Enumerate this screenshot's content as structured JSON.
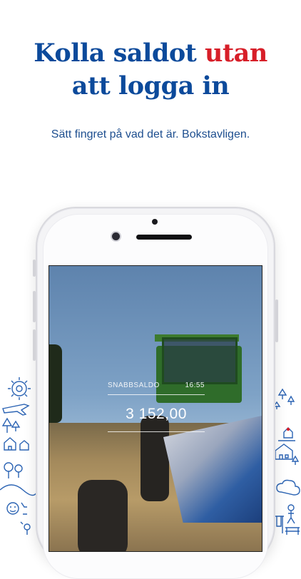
{
  "headline": {
    "line1_prefix": "Kolla saldot",
    "line1_accent": "utan",
    "line2": "att logga in"
  },
  "subtitle": "Sätt fingret på vad det är. Bokstavligen.",
  "screen": {
    "label": "SNABBSALDO",
    "time": "16:55",
    "balance": "3 152,00"
  },
  "colors": {
    "headline_blue": "#0c4a9b",
    "accent_red": "#d71e28",
    "subtitle_blue": "#1d4e8f",
    "doodle_blue": "#2b63b3"
  },
  "icons": {
    "left_doodles": [
      "sun-icon",
      "airplane-icon",
      "tree-icon",
      "house-icon",
      "balloon-icon",
      "person-icon"
    ],
    "right_doodles": [
      "tree-icon",
      "house-icon",
      "cloud-icon",
      "swing-icon",
      "bench-icon"
    ]
  }
}
